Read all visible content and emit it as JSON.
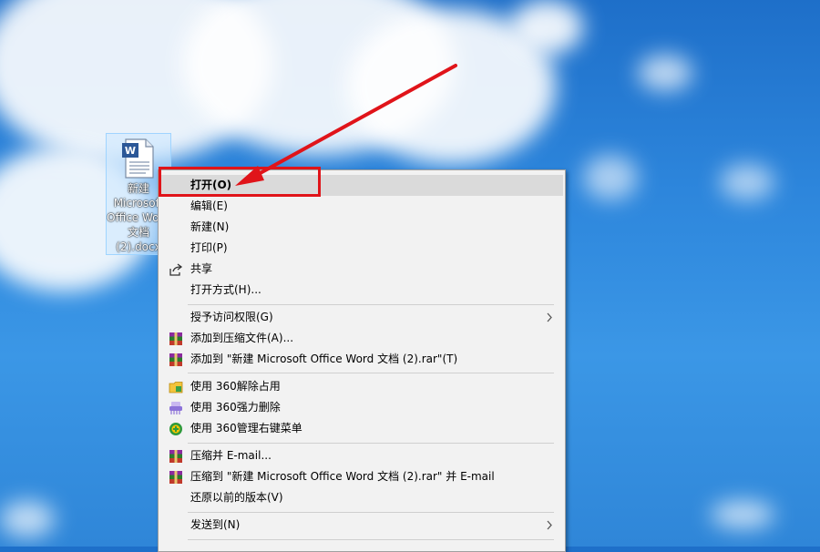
{
  "desktop_icon": {
    "caption": "新建\nMicrosoft\nOffice Word\n文档\n(2).docx"
  },
  "menu": {
    "items": [
      {
        "label": "打开(O)"
      },
      {
        "label": "编辑(E)"
      },
      {
        "label": "新建(N)"
      },
      {
        "label": "打印(P)"
      },
      {
        "label": "共享"
      },
      {
        "label": "打开方式(H)..."
      },
      {
        "label": "授予访问权限(G)"
      },
      {
        "label": "添加到压缩文件(A)..."
      },
      {
        "label": "添加到 \"新建 Microsoft Office Word 文档 (2).rar\"(T)"
      },
      {
        "label": "使用 360解除占用"
      },
      {
        "label": "使用 360强力删除"
      },
      {
        "label": "使用 360管理右键菜单"
      },
      {
        "label": "压缩并 E-mail..."
      },
      {
        "label": "压缩到 \"新建 Microsoft Office Word 文档 (2).rar\" 并 E-mail"
      },
      {
        "label": "还原以前的版本(V)"
      },
      {
        "label": "发送到(N)"
      }
    ]
  },
  "colors": {
    "annotation": "#e0141a",
    "menu_bg": "#f2f2f2",
    "highlight_bg": "#dadada"
  }
}
